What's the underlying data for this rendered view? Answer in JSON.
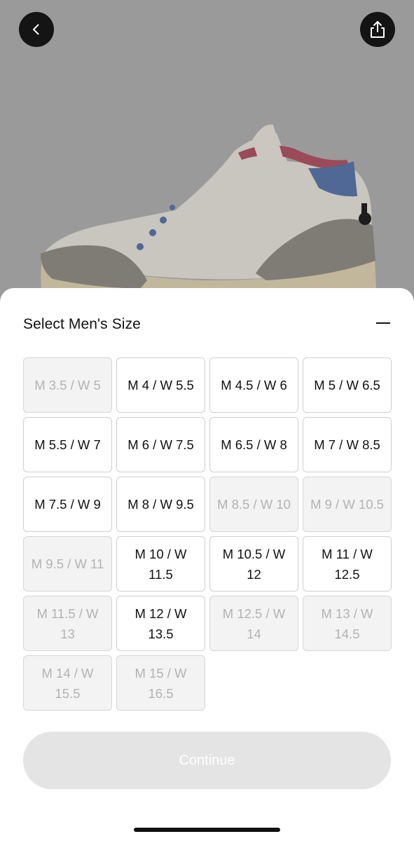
{
  "nav": {
    "back_icon": "chevron-left-icon",
    "share_icon": "share-icon"
  },
  "sheet": {
    "title": "Select Men's Size",
    "collapse_icon": "minus-icon"
  },
  "sizes": [
    {
      "label": "M 3.5 / W 5",
      "available": false
    },
    {
      "label": "M 4 / W 5.5",
      "available": true
    },
    {
      "label": "M 4.5 / W 6",
      "available": true
    },
    {
      "label": "M 5 / W 6.5",
      "available": true
    },
    {
      "label": "M 5.5 / W 7",
      "available": true
    },
    {
      "label": "M 6 / W 7.5",
      "available": true
    },
    {
      "label": "M 6.5 / W 8",
      "available": true
    },
    {
      "label": "M 7 / W 8.5",
      "available": true
    },
    {
      "label": "M 7.5 / W 9",
      "available": true
    },
    {
      "label": "M 8 / W 9.5",
      "available": true
    },
    {
      "label": "M 8.5 / W 10",
      "available": false
    },
    {
      "label": "M 9 / W 10.5",
      "available": false
    },
    {
      "label": "M 9.5 / W 11",
      "available": false
    },
    {
      "label": "M 10 / W 11.5",
      "available": true
    },
    {
      "label": "M 10.5 / W 12",
      "available": true
    },
    {
      "label": "M 11 / W 12.5",
      "available": true
    },
    {
      "label": "M 11.5 / W 13",
      "available": false
    },
    {
      "label": "M 12 / W 13.5",
      "available": true
    },
    {
      "label": "M 12.5 / W 14",
      "available": false
    },
    {
      "label": "M 13 / W 14.5",
      "available": false
    },
    {
      "label": "M 14 / W 15.5",
      "available": false
    },
    {
      "label": "M 15 / W 16.5",
      "available": false
    }
  ],
  "actions": {
    "continue_label": "Continue",
    "continue_enabled": false
  },
  "colors": {
    "overlay": "#9a9a9a",
    "text": "#111111",
    "disabled_text": "#b3b3b3",
    "disabled_bg": "#f3f3f3",
    "button_disabled_bg": "#e4e4e4"
  }
}
